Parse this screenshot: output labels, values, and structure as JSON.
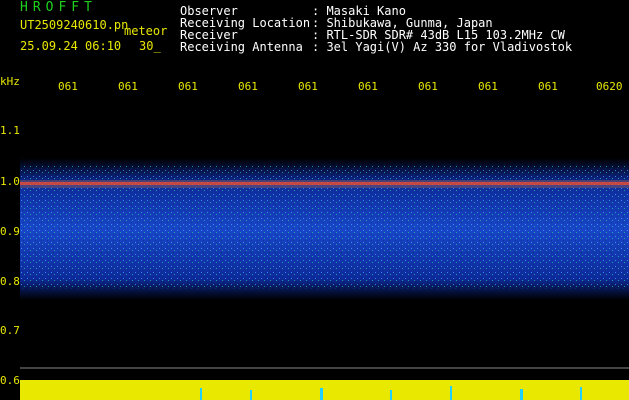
{
  "header": {
    "title": "HROFFT",
    "filename": "UT2509240610.pn",
    "meteor_label": "meteor",
    "date_time": "25.09.24 06:10",
    "duration": "30_",
    "info_rows": [
      {
        "label": "Observer",
        "value": ": Masaki Kano"
      },
      {
        "label": "Receiving Location",
        "value": ": Shibukawa, Gunma, Japan"
      },
      {
        "label": "Receiver",
        "value": ": RTL-SDR SDR# 43dB L15 103.2MHz CW"
      },
      {
        "label": "Receiving Antenna",
        "value": ": 3el Yagi(V) Az 330 for Vladivostok"
      }
    ]
  },
  "axis": {
    "unit": "kHz",
    "time_ticks": [
      "061",
      "061",
      "061",
      "061",
      "061",
      "061",
      "061",
      "061",
      "061",
      "0620"
    ],
    "freq_ticks": [
      "1.1",
      "1.0",
      "0.9",
      "0.8",
      "0.7",
      "0.6"
    ]
  },
  "colors": {
    "label": "#e8e800",
    "title": "#1dd11d",
    "noise": "#1846c8",
    "signal": "#e33"
  }
}
